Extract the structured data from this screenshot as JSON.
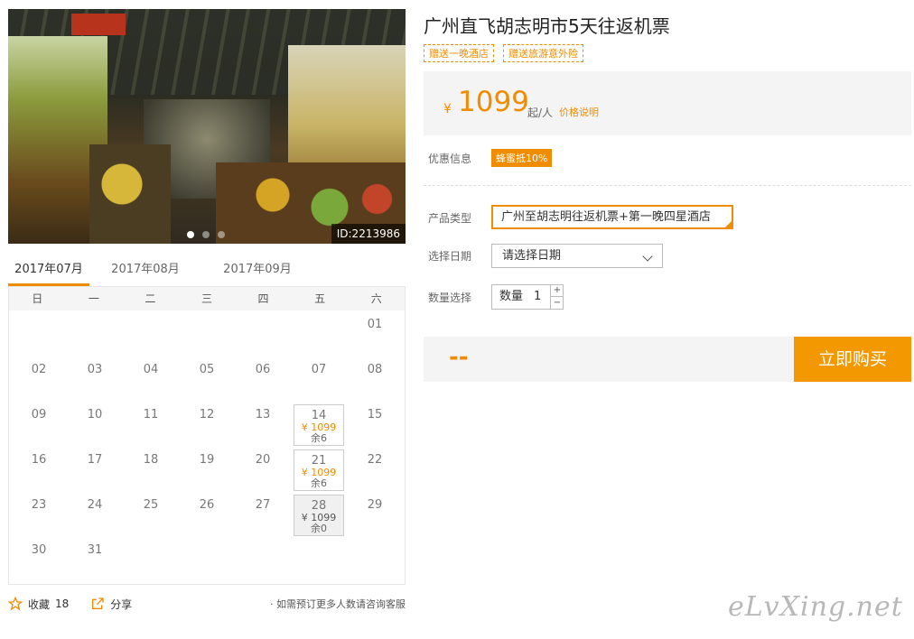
{
  "gallery": {
    "image_id": "ID:2213986",
    "dots": 3,
    "active_dot": 2
  },
  "months": [
    "2017年07月",
    "2017年08月",
    "2017年09月"
  ],
  "calendar": {
    "weekdays": [
      "日",
      "一",
      "二",
      "三",
      "四",
      "五",
      "六"
    ],
    "first_weekday": 6,
    "days_in_month": 31,
    "available": {
      "14": {
        "price": "¥ 1099",
        "left": "余6"
      },
      "21": {
        "price": "¥ 1099",
        "left": "余6"
      },
      "28": {
        "price": "¥ 1099",
        "left": "余0",
        "soldout": true
      }
    }
  },
  "footer": {
    "fav_label": "收藏",
    "fav_count": "18",
    "share_label": "分享",
    "note": "· 如需预订更多人数请咨询客服"
  },
  "product": {
    "title": "广州直飞胡志明市5天往返机票",
    "tags": [
      "赠送一晚酒店",
      "赠送旅游意外险"
    ],
    "price_symbol": "¥",
    "price": "1099",
    "per": "起/人",
    "price_explain": "价格说明",
    "discount_label": "优惠信息",
    "discount": "蜂蜜抵10%",
    "type_label": "产品类型",
    "type_value": "广州至胡志明往返机票+第一晚四星酒店",
    "date_label": "选择日期",
    "date_value": "请选择日期",
    "qty_label": "数量选择",
    "qty_prefix": "数量",
    "qty_value": "1",
    "total": "--",
    "buy": "立即购买"
  },
  "watermark": "eLvXing.net"
}
